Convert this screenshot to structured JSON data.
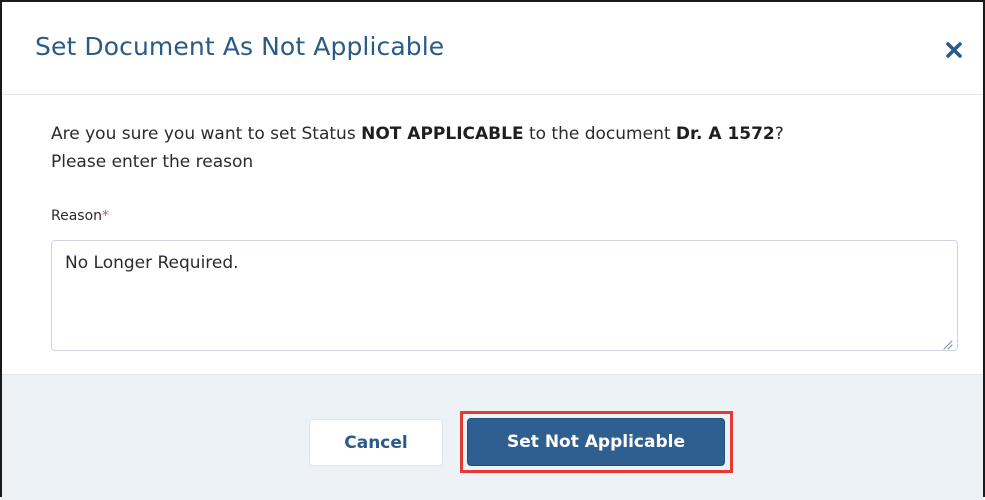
{
  "dialog": {
    "title": "Set Document As Not Applicable",
    "close_icon": "close-icon",
    "message": {
      "prefix": "Are you sure you want to set Status ",
      "status": "NOT APPLICABLE",
      "middle": " to the document ",
      "document": "Dr. A 1572",
      "suffix": "?",
      "line2": "Please enter the reason"
    },
    "reason": {
      "label": "Reason",
      "required_mark": "*",
      "value": "No Longer Required."
    },
    "buttons": {
      "cancel_label": "Cancel",
      "confirm_label": "Set Not Applicable"
    }
  },
  "colors": {
    "title": "#2a5a86",
    "primary_button": "#2f5f91",
    "footer_background": "#edf2f7",
    "highlight_border": "#e53935",
    "required_mark": "#d9534f"
  }
}
